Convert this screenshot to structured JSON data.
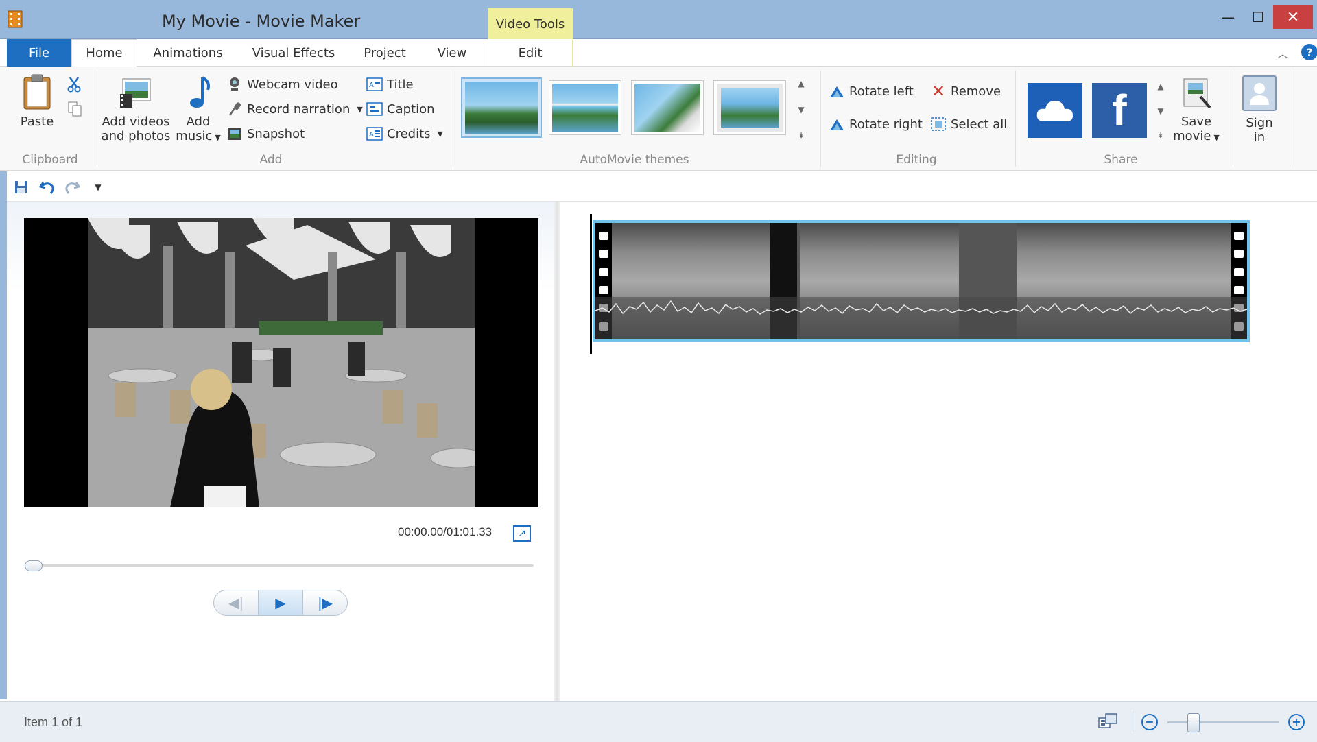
{
  "window": {
    "title": "My Movie - Movie Maker",
    "context_tab_header": "Video Tools",
    "controls": {
      "minimize": "—",
      "maximize": "☐",
      "close": "✕"
    }
  },
  "tabs": {
    "file": "File",
    "home": "Home",
    "animations": "Animations",
    "visual_effects": "Visual Effects",
    "project": "Project",
    "view": "View",
    "edit": "Edit"
  },
  "ribbon": {
    "clipboard": {
      "paste": "Paste",
      "group_label": "Clipboard"
    },
    "add": {
      "add_videos_line1": "Add videos",
      "add_videos_line2": "and photos",
      "add_music_line1": "Add",
      "add_music_line2": "music",
      "webcam_video": "Webcam video",
      "record_narration": "Record narration",
      "snapshot": "Snapshot",
      "title": "Title",
      "caption": "Caption",
      "credits": "Credits",
      "group_label": "Add"
    },
    "automovie": {
      "group_label": "AutoMovie themes"
    },
    "editing": {
      "rotate_left": "Rotate left",
      "rotate_right": "Rotate right",
      "remove": "Remove",
      "select_all": "Select all",
      "group_label": "Editing"
    },
    "share": {
      "save_movie_line1": "Save",
      "save_movie_line2": "movie",
      "group_label": "Share"
    },
    "sign_in": {
      "line1": "Sign",
      "line2": "in"
    }
  },
  "player": {
    "timecode": "00:00.00/01:01.33",
    "progress": 0.0
  },
  "status": {
    "item_text": "Item 1 of 1",
    "zoom_level": 0.2
  },
  "colors": {
    "accent": "#1e6fc2",
    "title_bar": "#98b8db",
    "context_tab": "#f0ef9c",
    "clip_selected_border": "#6fc3ea",
    "close_button": "#c94040"
  }
}
